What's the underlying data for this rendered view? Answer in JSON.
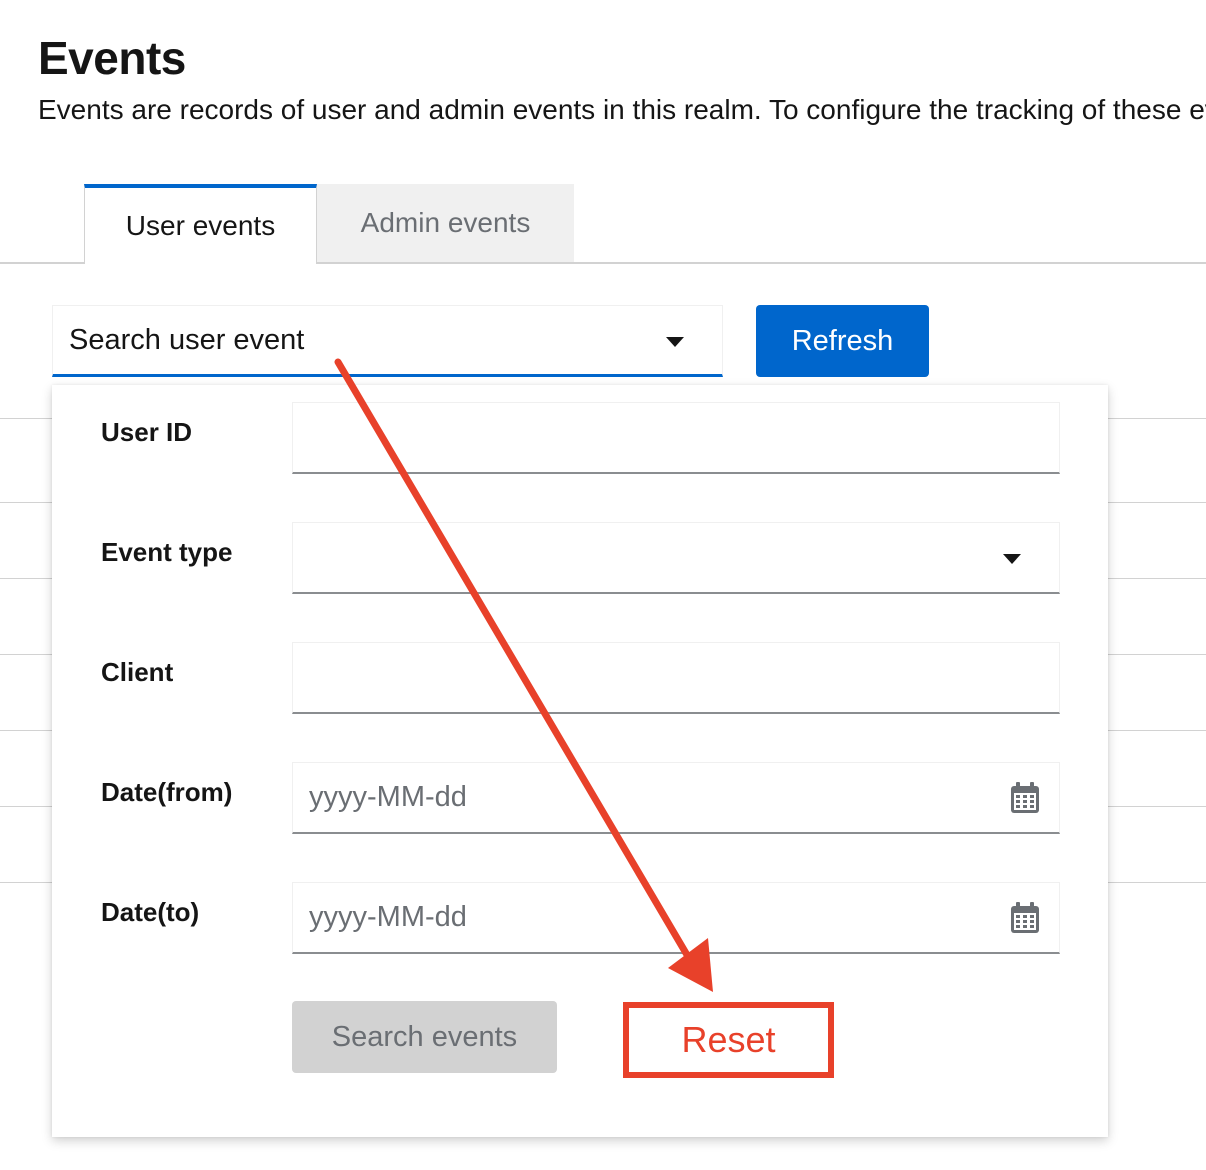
{
  "header": {
    "title": "Events",
    "description": "Events are records of user and admin events in this realm. To configure the tracking of these events, go to"
  },
  "tabs": [
    {
      "label": "User events",
      "active": true
    },
    {
      "label": "Admin events",
      "active": false
    }
  ],
  "toolbar": {
    "search_label": "Search user event",
    "refresh_label": "Refresh"
  },
  "search_form": {
    "user_id_label": "User ID",
    "user_id_value": "",
    "event_type_label": "Event type",
    "event_type_value": "",
    "client_label": "Client",
    "client_value": "",
    "date_from_label": "Date(from)",
    "date_from_placeholder": "yyyy-MM-dd",
    "date_to_label": "Date(to)",
    "date_to_placeholder": "yyyy-MM-dd",
    "search_button_label": "Search events",
    "reset_button_label": "Reset"
  },
  "icons": {
    "dropdown": "caret-down-icon",
    "date": "calendar-icon"
  },
  "colors": {
    "primary": "#0066cc",
    "annotation": "#e8412a",
    "disabled_bg": "#d2d2d2"
  }
}
